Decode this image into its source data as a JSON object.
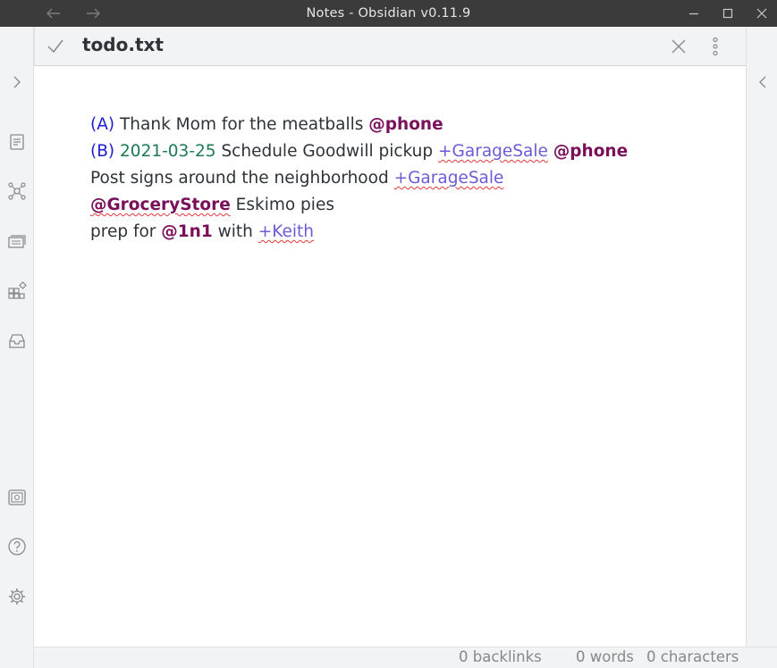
{
  "window": {
    "title": "Notes - Obsidian v0.11.9",
    "icons": [
      "back-arrow-icon",
      "forward-arrow-icon",
      "minimize-icon",
      "maximize-icon",
      "close-window-icon"
    ]
  },
  "ribbon": {
    "top_icons": [
      "open-quick-switcher-icon",
      "graph-view-icon",
      "slides-icon",
      "kanban-icon",
      "inbox-icon"
    ],
    "bottom_icons": [
      "vault-icon",
      "help-icon",
      "settings-icon"
    ]
  },
  "pane": {
    "title": "todo.txt",
    "icons": [
      "checkmark-icon",
      "close-pane-icon",
      "more-options-icon"
    ]
  },
  "todo": {
    "line1": {
      "priority": "(A)",
      "text": "Thank Mom for the meatballs",
      "context": "@phone"
    },
    "line2": {
      "priority": "(B)",
      "date": "2021-03-25",
      "text": "Schedule Goodwill pickup",
      "project": "+GarageSale",
      "context": "@phone"
    },
    "line3": {
      "text": "Post signs around the neighborhood",
      "project": "+GarageSale"
    },
    "line4": {
      "context": "@GroceryStore",
      "text": "Eskimo pies"
    },
    "line5": {
      "text_a": "prep for",
      "context": "@1n1",
      "text_b": "with",
      "project": "+Keith"
    }
  },
  "status": {
    "backlinks": "0 backlinks",
    "words": "0 words",
    "characters": "0 characters"
  },
  "colors": {
    "priority": "#1f1fd1",
    "date": "#1d7a53",
    "context": "#7a0f5a",
    "project": "#6a5cd6"
  }
}
